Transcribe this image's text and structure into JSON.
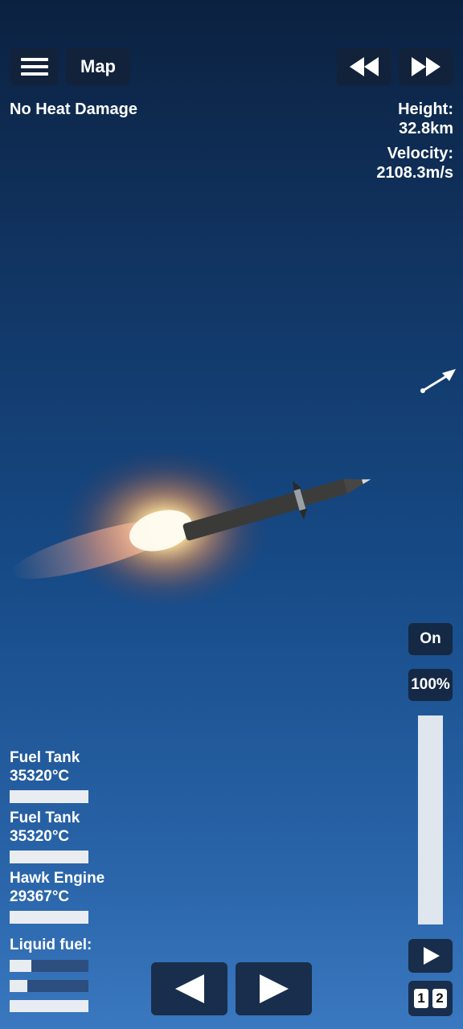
{
  "top_bar": {
    "map_label": "Map"
  },
  "status": {
    "heat_damage": "No Heat Damage",
    "height_label": "Height:",
    "height_value": "32.8km",
    "velocity_label": "Velocity:",
    "velocity_value": "2108.3m/s"
  },
  "parts": [
    {
      "name": "Fuel Tank",
      "temp": "35320°C",
      "level": 1.0
    },
    {
      "name": "Fuel Tank",
      "temp": "35320°C",
      "level": 1.0
    },
    {
      "name": "Hawk Engine",
      "temp": "29367°C",
      "level": 1.0
    }
  ],
  "fuel": {
    "label": "Liquid fuel:",
    "levels": [
      0.28,
      0.22,
      1.0
    ]
  },
  "engine": {
    "toggle_label": "On",
    "throttle_label": "100%",
    "throttle_level": 1.0
  },
  "stage": {
    "stage_1": "1",
    "stage_2": "2"
  },
  "icons": [
    "menu-icon",
    "rewind-icon",
    "fast-forward-icon",
    "direction-arrow-icon",
    "rotate-left-icon",
    "rotate-right-icon",
    "play-stage-icon"
  ]
}
